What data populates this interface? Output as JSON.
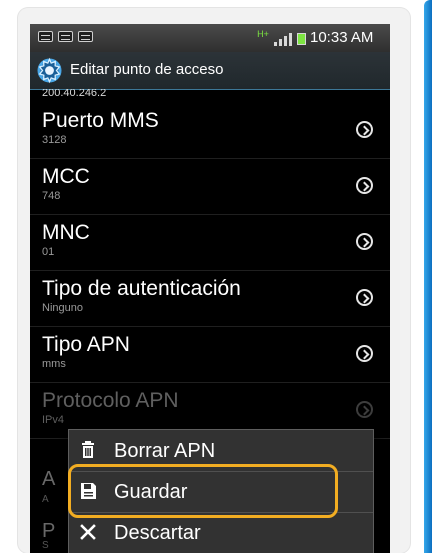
{
  "status_bar": {
    "time": "10:33 AM",
    "network": "H+"
  },
  "header": {
    "title": "Editar punto de acceso",
    "icon": "settings-icon"
  },
  "clipped_text": "200.40.246.2",
  "settings_items": [
    {
      "label": "Puerto MMS",
      "value": "3128",
      "enabled": true
    },
    {
      "label": "MCC",
      "value": "748",
      "enabled": true
    },
    {
      "label": "MNC",
      "value": "01",
      "enabled": true
    },
    {
      "label": "Tipo de autenticación",
      "value": "Ninguno",
      "enabled": true
    },
    {
      "label": "Tipo APN",
      "value": "mms",
      "enabled": true
    },
    {
      "label": "Protocolo APN",
      "value": "IPv4",
      "enabled": false
    }
  ],
  "remnants": {
    "a1": "A",
    "a2": "A",
    "p1": "P",
    "s1": "S"
  },
  "menu": {
    "items": [
      {
        "label": "Borrar APN",
        "icon": "trash-icon"
      },
      {
        "label": "Guardar",
        "icon": "save-icon"
      },
      {
        "label": "Descartar",
        "icon": "close-icon"
      }
    ]
  },
  "colors": {
    "highlight": "#f2ad22",
    "accent_blue": "#0b6fc0",
    "network_green": "#7be241"
  }
}
